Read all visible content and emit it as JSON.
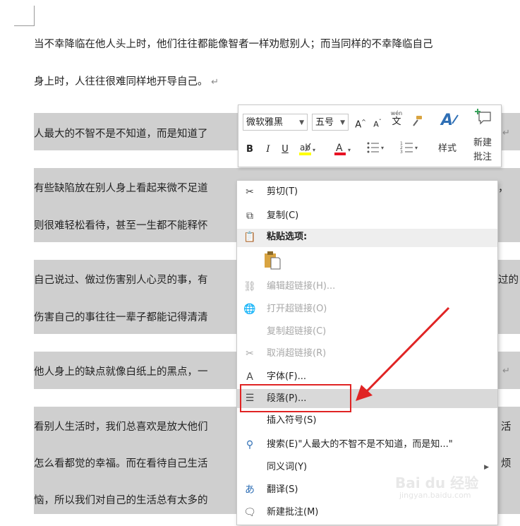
{
  "doc": {
    "lines": [
      "当不幸降临在他人头上时，他们往往都能像智者一样劝慰别人；而当同样的不幸降临自己",
      "身上时，人往往很难同样地开导自己。",
      "人最大的不智不是不知道，而是知道了",
      "有些缺陷放在别人身上看起来微不足道",
      "则很难轻松看待，甚至一生都不能释怀",
      "自己说过、做过伤害别人心灵的事，有",
      "伤害自己的事往往一辈子都能记得清清",
      "他人身上的缺点就像白纸上的黑点，一",
      "看别人生活时，我们总喜欢是放大他们",
      "怎么看都觉的幸福。而在看待自己生活",
      "恼，所以我们对自己的生活总有太多的"
    ],
    "right_fragments": [
      "，",
      "过的",
      "活",
      "烦"
    ],
    "para_mark": "↵"
  },
  "mini_toolbar": {
    "font_name": "微软雅黑",
    "font_size": "五号",
    "grow_font": "A",
    "shrink_font": "A",
    "pinyin": "wén",
    "pinyin_char": "文",
    "bold": "B",
    "italic": "I",
    "underline": "U",
    "font_color": "A",
    "styles_label": "样式",
    "new_comment_label_1": "新建",
    "new_comment_label_2": "批注"
  },
  "context_menu": {
    "items": [
      {
        "label": "剪切(T)",
        "icon": "scissors-icon"
      },
      {
        "label": "复制(C)",
        "icon": "copy-icon"
      },
      {
        "label": "粘贴选项:",
        "icon": "paste-icon"
      },
      {
        "label": "编辑超链接(H)...",
        "icon": "link-icon",
        "disabled": true
      },
      {
        "label": "打开超链接(O)",
        "icon": "globe-link-icon",
        "disabled": true
      },
      {
        "label": "复制超链接(C)",
        "disabled": true
      },
      {
        "label": "取消超链接(R)",
        "icon": "unlink-icon",
        "disabled": true
      },
      {
        "label": "字体(F)...",
        "icon": "font-icon"
      },
      {
        "label": "段落(P)...",
        "icon": "paragraph-icon"
      },
      {
        "label": "插入符号(S)"
      },
      {
        "label": "搜索(E)\"人最大的不智不是不知道，而是知...\"",
        "icon": "search-icon"
      },
      {
        "label": "同义词(Y)"
      },
      {
        "label": "翻译(S)",
        "icon": "translate-icon"
      },
      {
        "label": "新建批注(M)",
        "icon": "comment-icon"
      }
    ]
  },
  "watermark": {
    "text": "Bai du 经验",
    "url": "jingyan.baidu.com"
  },
  "colors": {
    "selection": "#cfcfcf",
    "highlight": "#d9d9d9",
    "annotation_red": "#e02424",
    "font_color_red": "#e81123",
    "highlight_yellow": "#ffff00"
  }
}
